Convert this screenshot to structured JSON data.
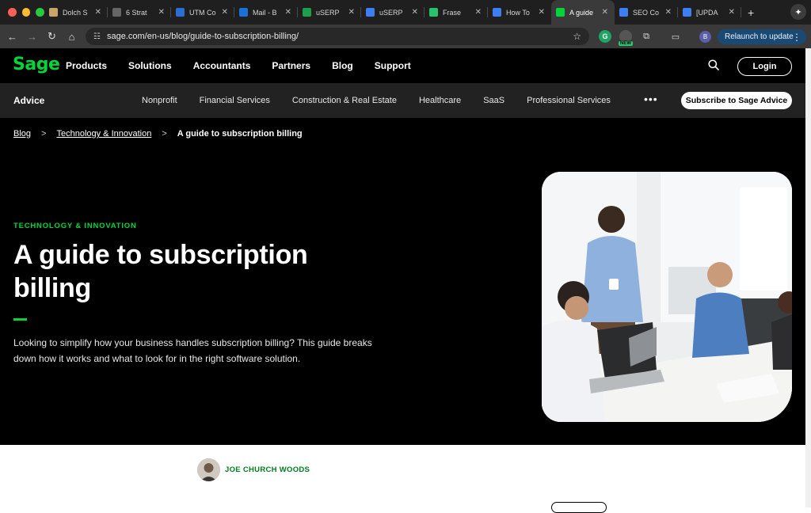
{
  "browser": {
    "tabs": [
      {
        "title": "Dolch S",
        "favicon": "star-icon",
        "color": "#c8a46a"
      },
      {
        "title": "6 Strat",
        "favicon": "page-icon",
        "color": "#666666"
      },
      {
        "title": "UTM Co",
        "favicon": "doc-icon",
        "color": "#2b6fd6"
      },
      {
        "title": "Mail - B",
        "favicon": "mail-icon",
        "color": "#1d6fd8"
      },
      {
        "title": "uSERP",
        "favicon": "sheet-icon",
        "color": "#1e9e4a"
      },
      {
        "title": "uSERP",
        "favicon": "doc-icon",
        "color": "#3d7ef0"
      },
      {
        "title": "Frase",
        "favicon": "frase-icon",
        "color": "#27c26b"
      },
      {
        "title": "How To",
        "favicon": "doc-icon",
        "color": "#3d7ef0"
      },
      {
        "title": "A guide",
        "favicon": "sage-icon",
        "color": "#00d639"
      },
      {
        "title": "SEO Co",
        "favicon": "doc-icon",
        "color": "#3d7ef0"
      },
      {
        "title": "[UPDA",
        "favicon": "doc-icon",
        "color": "#3d7ef0"
      }
    ],
    "active_tab": 8,
    "url": "sage.com/en-us/blog/guide-to-subscription-billing/",
    "relaunch_label": "Relaunch to update",
    "profile_initial": "B",
    "new_badge": "NEW"
  },
  "site": {
    "logo": "Sage",
    "nav": [
      "Products",
      "Solutions",
      "Accountants",
      "Partners",
      "Blog",
      "Support"
    ],
    "login_label": "Login",
    "advice_label": "Advice",
    "subnav": [
      "Nonprofit",
      "Financial Services",
      "Construction & Real Estate",
      "Healthcare",
      "SaaS",
      "Professional Services"
    ],
    "more_label": "•••",
    "subscribe_label": "Subscribe to Sage Advice"
  },
  "breadcrumb": {
    "blog": "Blog",
    "category": "Technology & Innovation",
    "current": "A guide to subscription billing"
  },
  "article": {
    "category": "TECHNOLOGY & INNOVATION",
    "title": "A guide to subscription billing",
    "summary": "Looking to simplify how your business handles subscription billing? This guide breaks down how it works and what to look for in the right software solution.",
    "author": "JOE CHURCH WOODS"
  },
  "colors": {
    "brand_green": "#00d639",
    "author_green": "#007d1f",
    "hero_bg": "#000000",
    "subnav_bg": "#222222"
  }
}
